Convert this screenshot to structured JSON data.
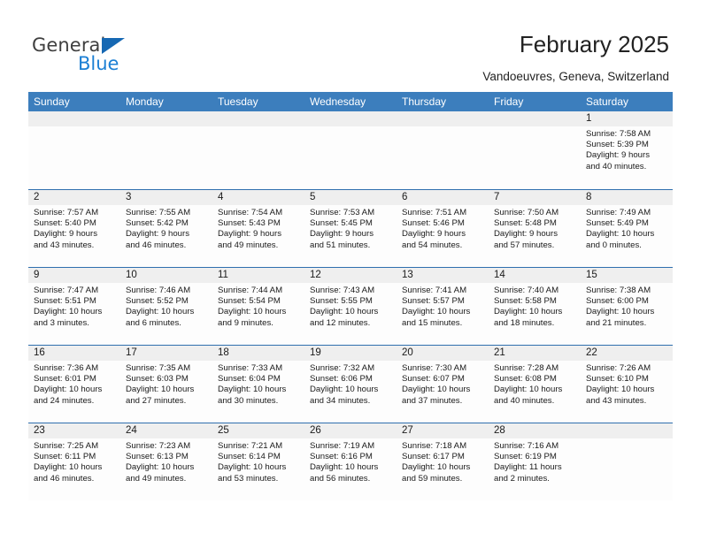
{
  "brand": {
    "name_part1": "General",
    "name_part2": "Blue",
    "accent_color": "#1668b3",
    "blue_text_color": "#1b7fd4"
  },
  "header": {
    "title": "February 2025",
    "subtitle": "Vandoeuvres, Geneva, Switzerland"
  },
  "calendar": {
    "header_bg": "#3c7ebd",
    "row_divider": "#2f6fae",
    "day_number_bg": "#efefef",
    "weekdays": [
      "Sunday",
      "Monday",
      "Tuesday",
      "Wednesday",
      "Thursday",
      "Friday",
      "Saturday"
    ],
    "weeks": [
      [
        {
          "day": "",
          "lines": []
        },
        {
          "day": "",
          "lines": []
        },
        {
          "day": "",
          "lines": []
        },
        {
          "day": "",
          "lines": []
        },
        {
          "day": "",
          "lines": []
        },
        {
          "day": "",
          "lines": []
        },
        {
          "day": "1",
          "lines": [
            "Sunrise: 7:58 AM",
            "Sunset: 5:39 PM",
            "Daylight: 9 hours",
            "and 40 minutes."
          ]
        }
      ],
      [
        {
          "day": "2",
          "lines": [
            "Sunrise: 7:57 AM",
            "Sunset: 5:40 PM",
            "Daylight: 9 hours",
            "and 43 minutes."
          ]
        },
        {
          "day": "3",
          "lines": [
            "Sunrise: 7:55 AM",
            "Sunset: 5:42 PM",
            "Daylight: 9 hours",
            "and 46 minutes."
          ]
        },
        {
          "day": "4",
          "lines": [
            "Sunrise: 7:54 AM",
            "Sunset: 5:43 PM",
            "Daylight: 9 hours",
            "and 49 minutes."
          ]
        },
        {
          "day": "5",
          "lines": [
            "Sunrise: 7:53 AM",
            "Sunset: 5:45 PM",
            "Daylight: 9 hours",
            "and 51 minutes."
          ]
        },
        {
          "day": "6",
          "lines": [
            "Sunrise: 7:51 AM",
            "Sunset: 5:46 PM",
            "Daylight: 9 hours",
            "and 54 minutes."
          ]
        },
        {
          "day": "7",
          "lines": [
            "Sunrise: 7:50 AM",
            "Sunset: 5:48 PM",
            "Daylight: 9 hours",
            "and 57 minutes."
          ]
        },
        {
          "day": "8",
          "lines": [
            "Sunrise: 7:49 AM",
            "Sunset: 5:49 PM",
            "Daylight: 10 hours",
            "and 0 minutes."
          ]
        }
      ],
      [
        {
          "day": "9",
          "lines": [
            "Sunrise: 7:47 AM",
            "Sunset: 5:51 PM",
            "Daylight: 10 hours",
            "and 3 minutes."
          ]
        },
        {
          "day": "10",
          "lines": [
            "Sunrise: 7:46 AM",
            "Sunset: 5:52 PM",
            "Daylight: 10 hours",
            "and 6 minutes."
          ]
        },
        {
          "day": "11",
          "lines": [
            "Sunrise: 7:44 AM",
            "Sunset: 5:54 PM",
            "Daylight: 10 hours",
            "and 9 minutes."
          ]
        },
        {
          "day": "12",
          "lines": [
            "Sunrise: 7:43 AM",
            "Sunset: 5:55 PM",
            "Daylight: 10 hours",
            "and 12 minutes."
          ]
        },
        {
          "day": "13",
          "lines": [
            "Sunrise: 7:41 AM",
            "Sunset: 5:57 PM",
            "Daylight: 10 hours",
            "and 15 minutes."
          ]
        },
        {
          "day": "14",
          "lines": [
            "Sunrise: 7:40 AM",
            "Sunset: 5:58 PM",
            "Daylight: 10 hours",
            "and 18 minutes."
          ]
        },
        {
          "day": "15",
          "lines": [
            "Sunrise: 7:38 AM",
            "Sunset: 6:00 PM",
            "Daylight: 10 hours",
            "and 21 minutes."
          ]
        }
      ],
      [
        {
          "day": "16",
          "lines": [
            "Sunrise: 7:36 AM",
            "Sunset: 6:01 PM",
            "Daylight: 10 hours",
            "and 24 minutes."
          ]
        },
        {
          "day": "17",
          "lines": [
            "Sunrise: 7:35 AM",
            "Sunset: 6:03 PM",
            "Daylight: 10 hours",
            "and 27 minutes."
          ]
        },
        {
          "day": "18",
          "lines": [
            "Sunrise: 7:33 AM",
            "Sunset: 6:04 PM",
            "Daylight: 10 hours",
            "and 30 minutes."
          ]
        },
        {
          "day": "19",
          "lines": [
            "Sunrise: 7:32 AM",
            "Sunset: 6:06 PM",
            "Daylight: 10 hours",
            "and 34 minutes."
          ]
        },
        {
          "day": "20",
          "lines": [
            "Sunrise: 7:30 AM",
            "Sunset: 6:07 PM",
            "Daylight: 10 hours",
            "and 37 minutes."
          ]
        },
        {
          "day": "21",
          "lines": [
            "Sunrise: 7:28 AM",
            "Sunset: 6:08 PM",
            "Daylight: 10 hours",
            "and 40 minutes."
          ]
        },
        {
          "day": "22",
          "lines": [
            "Sunrise: 7:26 AM",
            "Sunset: 6:10 PM",
            "Daylight: 10 hours",
            "and 43 minutes."
          ]
        }
      ],
      [
        {
          "day": "23",
          "lines": [
            "Sunrise: 7:25 AM",
            "Sunset: 6:11 PM",
            "Daylight: 10 hours",
            "and 46 minutes."
          ]
        },
        {
          "day": "24",
          "lines": [
            "Sunrise: 7:23 AM",
            "Sunset: 6:13 PM",
            "Daylight: 10 hours",
            "and 49 minutes."
          ]
        },
        {
          "day": "25",
          "lines": [
            "Sunrise: 7:21 AM",
            "Sunset: 6:14 PM",
            "Daylight: 10 hours",
            "and 53 minutes."
          ]
        },
        {
          "day": "26",
          "lines": [
            "Sunrise: 7:19 AM",
            "Sunset: 6:16 PM",
            "Daylight: 10 hours",
            "and 56 minutes."
          ]
        },
        {
          "day": "27",
          "lines": [
            "Sunrise: 7:18 AM",
            "Sunset: 6:17 PM",
            "Daylight: 10 hours",
            "and 59 minutes."
          ]
        },
        {
          "day": "28",
          "lines": [
            "Sunrise: 7:16 AM",
            "Sunset: 6:19 PM",
            "Daylight: 11 hours",
            "and 2 minutes."
          ]
        },
        {
          "day": "",
          "lines": []
        }
      ]
    ]
  }
}
